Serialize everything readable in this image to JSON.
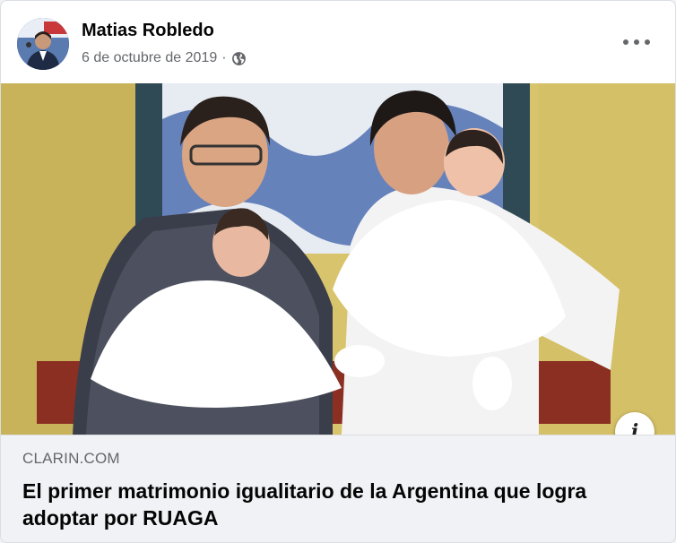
{
  "post": {
    "author": "Matias Robledo",
    "date": "6 de octubre de 2019",
    "separator": "·",
    "privacy_icon": "globe-icon",
    "more_icon": "more-options-icon"
  },
  "link_preview": {
    "domain": "CLARIN.COM",
    "title": "El primer matrimonio igualitario de la Argentina que logra adoptar por RUAGA",
    "info_label": "i"
  },
  "colors": {
    "card_bg": "#ffffff",
    "page_bg": "#f0f2f5",
    "link_bg": "#f0f2f5",
    "text_primary": "#050505",
    "text_secondary": "#65676b"
  }
}
